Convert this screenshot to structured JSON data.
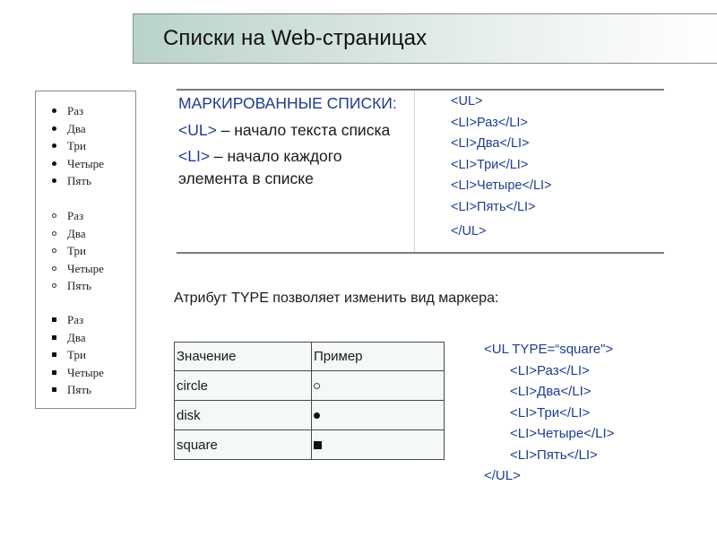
{
  "title": "Списки на Web-страницах",
  "browser_sample": {
    "lists": [
      {
        "marker": "disc",
        "items": [
          "Раз",
          "Два",
          "Три",
          "Четыре",
          "Пять"
        ]
      },
      {
        "marker": "circle",
        "items": [
          "Раз",
          "Два",
          "Три",
          "Четыре",
          "Пять"
        ]
      },
      {
        "marker": "square",
        "items": [
          "Раз",
          "Два",
          "Три",
          "Четыре",
          "Пять"
        ]
      }
    ]
  },
  "top_table": {
    "heading": "МАРКИРОВАННЫЕ СПИСКИ:",
    "ul_tag": "<UL>",
    "ul_desc": " – начало текста списка",
    "li_tag": "<LI>",
    "li_desc": " – начало каждого элемента в списке",
    "code_lines": [
      "<UL>",
      "<LI>Раз</LI>",
      "<LI>Два</LI>",
      "<LI>Три</LI>",
      "<LI>Четыре</LI>",
      "<LI>Пять</LI>",
      "</UL>"
    ]
  },
  "attribute_text": "Атрибут TYPE позволяет изменить вид маркера:",
  "values_table": {
    "headers": [
      "Значение",
      "Пример"
    ],
    "rows": [
      {
        "value": "circle",
        "example_icon": "circle-marker-icon"
      },
      {
        "value": "disk",
        "example_icon": "disc-marker-icon"
      },
      {
        "value": "square",
        "example_icon": "square-marker-icon"
      }
    ]
  },
  "code_example": {
    "open": "<UL TYPE=“square\">",
    "items": [
      "<LI>Раз</LI>",
      "<LI>Два</LI>",
      "<LI>Три</LI>",
      "<LI>Четыре</LI>",
      "<LI>Пять</LI>"
    ],
    "close": "</UL>"
  },
  "colors": {
    "code_blue": "#1f3c8f",
    "title_gradient_start": "#b9d3c8",
    "table_bg": "#f4f8f7"
  }
}
